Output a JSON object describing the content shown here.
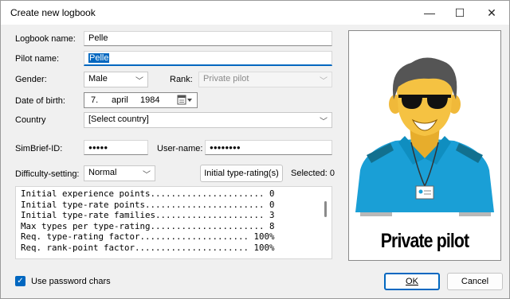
{
  "window": {
    "title": "Create new logbook",
    "minimize": "—",
    "maximize": "☐",
    "close": "✕"
  },
  "form": {
    "logbook_name_label": "Logbook name:",
    "logbook_name_value": "Pelle",
    "pilot_name_label": "Pilot name:",
    "pilot_name_value": "Pelle",
    "gender_label": "Gender:",
    "gender_value": "Male",
    "rank_label": "Rank:",
    "rank_value": "Private pilot",
    "dob_label": "Date of birth:",
    "dob_day": "7.",
    "dob_month": "april",
    "dob_year": "1984",
    "country_label": "Country",
    "country_value": "[Select country]",
    "simbrief_label": "SimBrief-ID:",
    "simbrief_value": "●●●●●",
    "username_label": "User-name:",
    "username_value": "●●●●●●●●",
    "difficulty_label": "Difficulty-setting:",
    "difficulty_value": "Normal",
    "typerating_button": "Initial type-rating(s)",
    "selected_label": "Selected: 0"
  },
  "stats": {
    "lines": [
      "Initial experience points...................... 0",
      "Initial type-rate points....................... 0",
      "Initial type-rate families..................... 3",
      "Max types per type-rating...................... 8",
      "Req. type-rating factor..................... 100%",
      "Req. rank-point factor...................... 100%"
    ]
  },
  "portrait": {
    "caption": "Private pilot"
  },
  "footer": {
    "password_chars_label": "Use password chars",
    "password_chars_checked": "✓",
    "ok_label": "OK",
    "cancel_label": "Cancel"
  },
  "colors": {
    "accent": "#0067c0",
    "shirt": "#1a9fd6",
    "skin": "#f5c242"
  }
}
